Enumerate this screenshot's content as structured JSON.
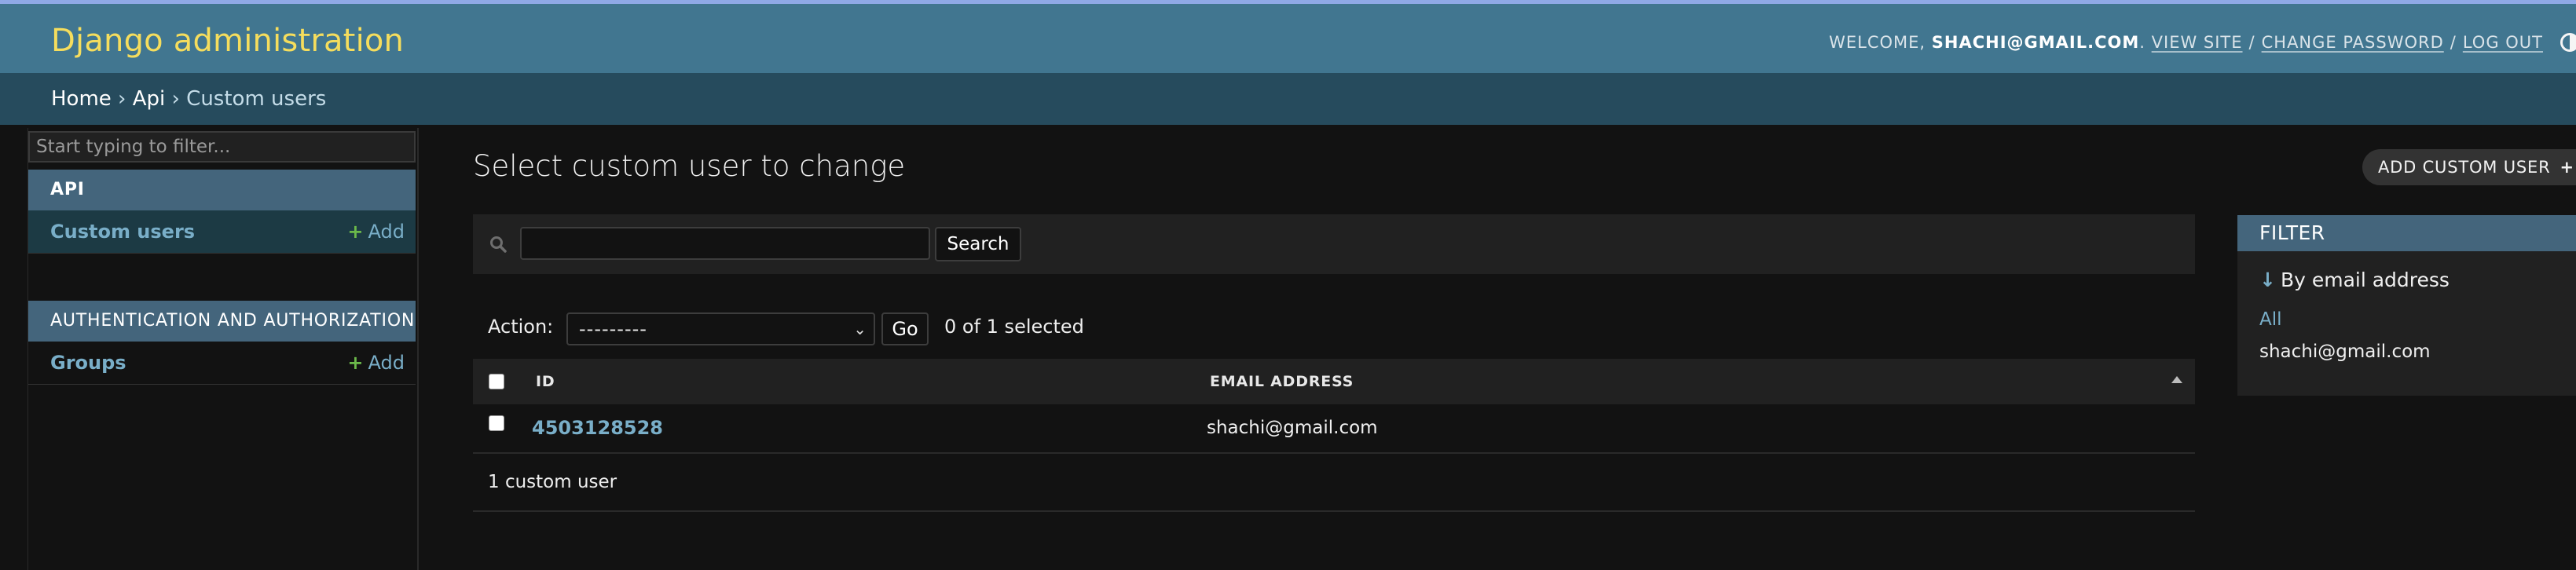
{
  "header": {
    "brand": "Django administration",
    "welcome": "WELCOME,",
    "username": "SHACHI@GMAIL.COM",
    "period": ".",
    "view_site": "VIEW SITE",
    "change_password": "CHANGE PASSWORD",
    "log_out": "LOG OUT",
    "separator": "/",
    "theme_toggle_icon": "half-circle-icon"
  },
  "breadcrumbs": {
    "home": "Home",
    "sep": "›",
    "app": "Api",
    "current": "Custom users"
  },
  "sidebar": {
    "filter_placeholder": "Start typing to filter...",
    "apps": [
      {
        "caption": "API",
        "models": [
          {
            "name": "Custom users",
            "add": "Add",
            "selected": true
          }
        ]
      },
      {
        "caption": "AUTHENTICATION AND AUTHORIZATION",
        "models": [
          {
            "name": "Groups",
            "add": "Add",
            "selected": false
          }
        ]
      }
    ],
    "add_plus": "+"
  },
  "main": {
    "title": "Select custom user to change",
    "add_button": "ADD CUSTOM USER",
    "add_icon": "+",
    "search": {
      "value": "",
      "button": "Search",
      "icon": "search-icon"
    },
    "actions": {
      "label": "Action:",
      "selected_option": "---------",
      "go": "Go",
      "selected_count": "0 of 1 selected"
    },
    "table": {
      "columns": [
        "ID",
        "EMAIL ADDRESS"
      ],
      "rows": [
        {
          "id": "4503128528",
          "email": "shachi@gmail.com"
        }
      ]
    },
    "paginator": "1 custom user"
  },
  "filter": {
    "title": "FILTER",
    "heading": "By email address",
    "arrow": "↓",
    "options": [
      "All",
      "shachi@gmail.com"
    ]
  },
  "colors": {
    "header_bg": "#417690",
    "breadcrumbs_bg": "#264b5d",
    "brand": "#f5dd5d",
    "link": "#79aec8",
    "module_caption_bg": "#44657c",
    "add_plus": "#6bb84a"
  }
}
